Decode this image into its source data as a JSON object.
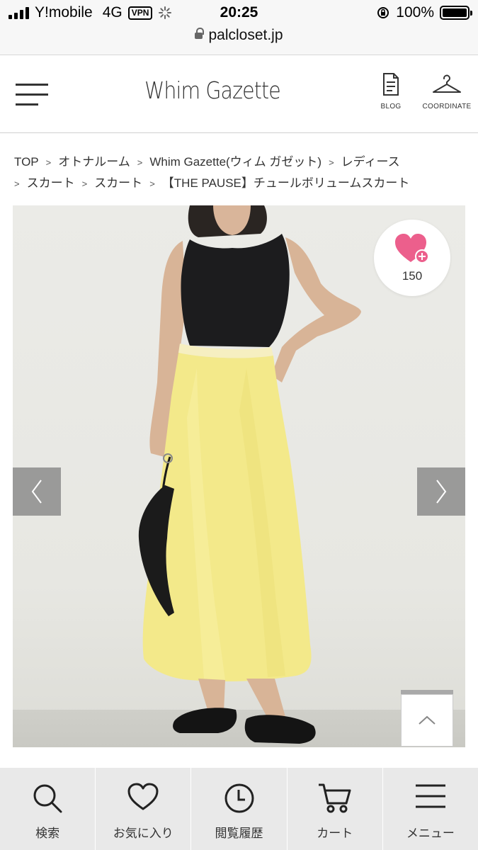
{
  "status_bar": {
    "carrier": "Y!mobile",
    "network": "4G",
    "vpn": "VPN",
    "time": "20:25",
    "battery": "100%",
    "url": "palcloset.jp"
  },
  "header": {
    "logo": "Whim Gazette",
    "blog_label": "BLOG",
    "coordinate_label": "COORDINATE"
  },
  "breadcrumb": {
    "items": [
      "TOP",
      "オトナルーム",
      "Whim Gazette(ウィム ガゼット)",
      "レディース",
      "スカート",
      "スカート",
      "【THE PAUSE】チュールボリュームスカート"
    ]
  },
  "product": {
    "favorite_count": "150",
    "colors": {
      "skirt": "#f3e98a",
      "top": "#1c1c1e",
      "background": "#e8e8e3",
      "heart": "#ec5f8c"
    }
  },
  "bottom_nav": {
    "items": [
      {
        "label": "検索",
        "icon": "search-icon"
      },
      {
        "label": "お気に入り",
        "icon": "heart-icon"
      },
      {
        "label": "閲覧履歴",
        "icon": "clock-icon"
      },
      {
        "label": "カート",
        "icon": "cart-icon"
      },
      {
        "label": "メニュー",
        "icon": "menu-icon"
      }
    ]
  }
}
